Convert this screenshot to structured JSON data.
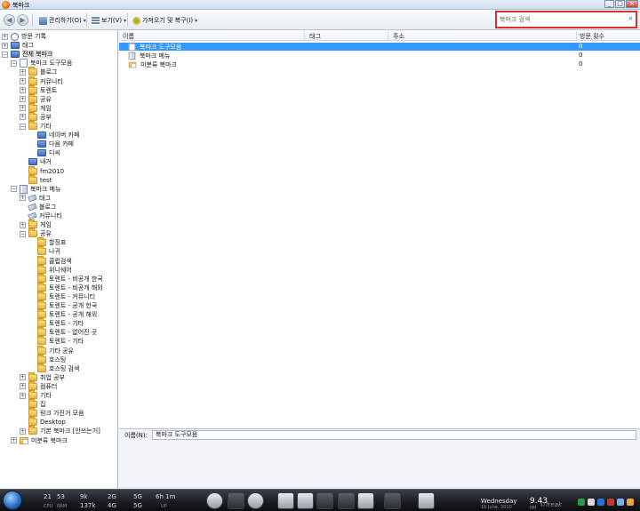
{
  "window": {
    "title": "북마크",
    "controls": [
      "_",
      "□",
      "×"
    ]
  },
  "toolbar": {
    "back": "◀",
    "forward": "▶",
    "organize": "관리하기(O)",
    "view": "보기(V)",
    "import": "가져오기 및 복구(I)",
    "caret": "▾",
    "search_placeholder": "북마크 검색",
    "search_icon": "⌕"
  },
  "sidebar": {
    "items": [
      {
        "label": "방문 기록",
        "icon": "clock-icon",
        "depth": 0,
        "expander": "+"
      },
      {
        "label": "태그",
        "icon": "tag-folder-icon",
        "depth": 0,
        "expander": "+"
      },
      {
        "label": "전체 북마크",
        "icon": "all-bookmarks-icon",
        "depth": 0,
        "expander": "−",
        "selected": true
      },
      {
        "label": "북마크 도구모음",
        "icon": "toolbar-icon",
        "depth": 1,
        "expander": "−"
      },
      {
        "label": "블로그",
        "icon": "folder-icon",
        "depth": 2,
        "expander": "+"
      },
      {
        "label": "커뮤니티",
        "icon": "folder-icon",
        "depth": 2,
        "expander": "+"
      },
      {
        "label": "토렌트",
        "icon": "folder-icon",
        "depth": 2,
        "expander": "+"
      },
      {
        "label": "공유",
        "icon": "folder-icon",
        "depth": 2,
        "expander": "+"
      },
      {
        "label": "게임",
        "icon": "folder-icon",
        "depth": 2,
        "expander": "+"
      },
      {
        "label": "공부",
        "icon": "folder-icon",
        "depth": 2,
        "expander": "+"
      },
      {
        "label": "기타",
        "icon": "folder-icon",
        "depth": 2,
        "expander": "−"
      },
      {
        "label": "네이버 카페",
        "icon": "bookmark-folder-icon",
        "depth": 3,
        "expander": ""
      },
      {
        "label": "다음 카페",
        "icon": "bookmark-folder-icon",
        "depth": 3,
        "expander": ""
      },
      {
        "label": "디씨",
        "icon": "bookmark-folder-icon",
        "depth": 3,
        "expander": ""
      },
      {
        "label": "내거",
        "icon": "bookmark-folder-icon",
        "depth": 2,
        "expander": ""
      },
      {
        "label": "fm2010",
        "icon": "folder-icon",
        "depth": 2,
        "expander": ""
      },
      {
        "label": "test",
        "icon": "folder-icon",
        "depth": 2,
        "expander": ""
      },
      {
        "label": "북마크 메뉴",
        "icon": "menu-icon",
        "depth": 1,
        "expander": "−"
      },
      {
        "label": "태그",
        "icon": "tag-icon",
        "depth": 2,
        "expander": "+"
      },
      {
        "label": "블로그",
        "icon": "tag-icon",
        "depth": 2,
        "expander": ""
      },
      {
        "label": "커뮤니티",
        "icon": "tag-icon",
        "depth": 2,
        "expander": ""
      },
      {
        "label": "게임",
        "icon": "folder-icon",
        "depth": 2,
        "expander": "+"
      },
      {
        "label": "공유",
        "icon": "folder-icon",
        "depth": 2,
        "expander": "−"
      },
      {
        "label": "할징표",
        "icon": "folder-icon",
        "depth": 3,
        "expander": ""
      },
      {
        "label": "나귀",
        "icon": "folder-icon",
        "depth": 3,
        "expander": ""
      },
      {
        "label": "클럽검색",
        "icon": "folder-icon",
        "depth": 3,
        "expander": ""
      },
      {
        "label": "위니쉐어",
        "icon": "folder-icon",
        "depth": 3,
        "expander": ""
      },
      {
        "label": "토렌트 - 비공개 한국",
        "icon": "folder-icon",
        "depth": 3,
        "expander": ""
      },
      {
        "label": "토렌트 - 비공개 해외",
        "icon": "folder-icon",
        "depth": 3,
        "expander": ""
      },
      {
        "label": "토렌트 - 커뮤니티",
        "icon": "folder-icon",
        "depth": 3,
        "expander": ""
      },
      {
        "label": "토렌트 - 공개 한국",
        "icon": "folder-icon",
        "depth": 3,
        "expander": ""
      },
      {
        "label": "토렌트 - 공개 해외",
        "icon": "folder-icon",
        "depth": 3,
        "expander": ""
      },
      {
        "label": "토렌트 - 기타",
        "icon": "folder-icon",
        "depth": 3,
        "expander": ""
      },
      {
        "label": "토렌트 - 없어진 곳",
        "icon": "folder-icon",
        "depth": 3,
        "expander": ""
      },
      {
        "label": "토렌트 - 기타",
        "icon": "folder-icon",
        "depth": 3,
        "expander": ""
      },
      {
        "label": "기타 공유",
        "icon": "folder-icon",
        "depth": 3,
        "expander": ""
      },
      {
        "label": "호스팅",
        "icon": "folder-icon",
        "depth": 3,
        "expander": ""
      },
      {
        "label": "호스팅 검색",
        "icon": "folder-icon",
        "depth": 3,
        "expander": ""
      },
      {
        "label": "취업 공부",
        "icon": "folder-icon",
        "depth": 2,
        "expander": "+"
      },
      {
        "label": "컴퓨터",
        "icon": "folder-icon",
        "depth": 2,
        "expander": "+"
      },
      {
        "label": "기타",
        "icon": "folder-icon",
        "depth": 2,
        "expander": "+"
      },
      {
        "label": "집",
        "icon": "folder-icon",
        "depth": 2,
        "expander": ""
      },
      {
        "label": "링크 가진거 모음",
        "icon": "folder-icon",
        "depth": 2,
        "expander": ""
      },
      {
        "label": "Desktop",
        "icon": "folder-icon",
        "depth": 2,
        "expander": ""
      },
      {
        "label": "기본 북마크 [안쓰는거]",
        "icon": "folder-icon",
        "depth": 2,
        "expander": "+"
      },
      {
        "label": "미분류 북마크",
        "icon": "unsorted-icon",
        "depth": 1,
        "expander": "+"
      }
    ]
  },
  "list": {
    "columns": [
      "이름",
      "태그",
      "주소",
      "방문 횟수"
    ],
    "rows": [
      {
        "name": "북마크 도구모음",
        "visits": "0",
        "icon": "toolbar-icon",
        "selected": true
      },
      {
        "name": "북마크 메뉴",
        "visits": "0",
        "icon": "menu-icon",
        "selected": false
      },
      {
        "name": "미분류 북마크",
        "visits": "0",
        "icon": "unsorted-icon",
        "selected": false
      }
    ]
  },
  "detail": {
    "name_label": "이름(N):",
    "name_value": "북마크 도구모음"
  },
  "taskbar": {
    "cpu": "21",
    "cpu_label": "CPU",
    "ram": "53",
    "ram_label": "RAM",
    "net_down": "9k",
    "net_up": "137k",
    "disk1": "2G",
    "disk2": "4G",
    "disk3": "5G",
    "disk4": "5G",
    "uptime": "6h 1m",
    "uptime_label": "UP",
    "day": "Wednesday",
    "date": "16 June, 2010",
    "time": "9.43",
    "ampm": "PM",
    "brand": "©freak"
  }
}
